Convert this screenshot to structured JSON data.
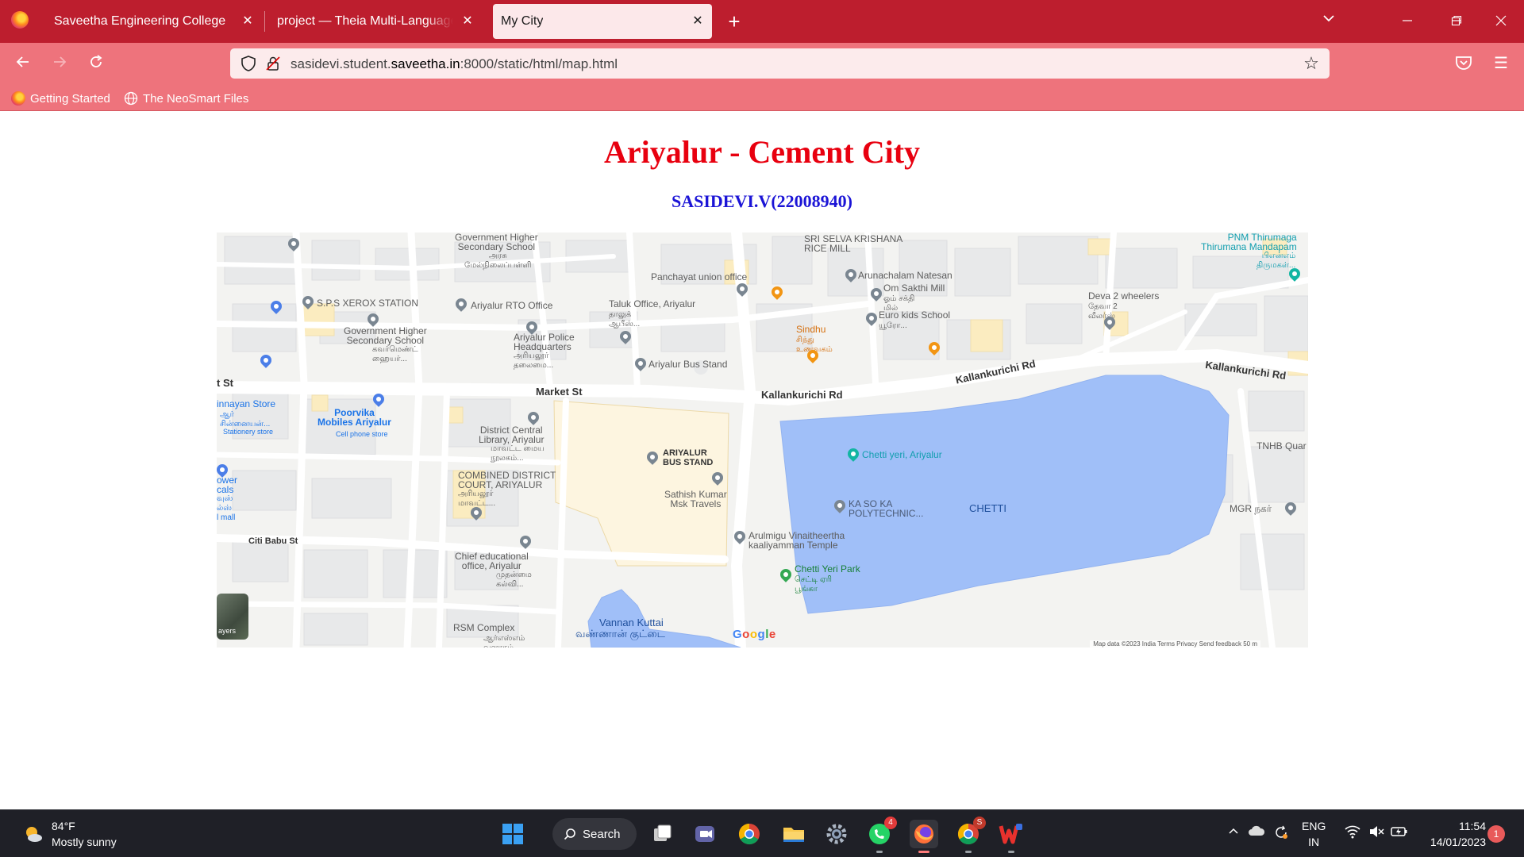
{
  "browser": {
    "tabs": [
      {
        "label": "Saveetha Engineering College"
      },
      {
        "label": "project — Theia Multi-Language Ex"
      },
      {
        "label": "My City"
      }
    ],
    "url": {
      "prefix": "sasidevi.student.",
      "host": "saveetha.in",
      "suffix": ":8000/static/html/map.html"
    },
    "bookmarks": [
      {
        "label": "Getting Started"
      },
      {
        "label": "The NeoSmart Files"
      }
    ]
  },
  "page": {
    "title": "Ariyalur - Cement City",
    "subtitle": "SASIDEVI.V(22008940)"
  },
  "map": {
    "roads": [
      {
        "label": "Market St"
      },
      {
        "label": "Kallankurichi Rd"
      },
      {
        "label": "Kallankurichi Rd"
      },
      {
        "label": "Kallankurichi Rd"
      },
      {
        "label": "Citi Babu St"
      },
      {
        "label": "t St"
      }
    ],
    "places": {
      "gov_school_top": "Government Higher\nSecondary School",
      "gov_school_top_ta": "அரசு\nமேல்நிலைப்பள்ளி",
      "selva": "SRI SELVA KRISHANA\nRICE MILL",
      "panchayat": "Panchayat union office",
      "arunachalam": "Arunachalam Natesan",
      "om_sakthi": "Om Sakthi Mill",
      "om_sakthi_ta": "ஓம் சக்தி\nமில்",
      "thirumana": "PNM Thirumaga\nThirumana Mandapam",
      "thirumana_ta": "பிஎன்எம்\nதிருமகள்...",
      "sps": "S.P.S XEROX STATION",
      "rto": "Ariyalur RTO Office",
      "taluk": "Taluk Office, Ariyalur",
      "taluk_ta": "தாலுக்\nஆபீஸ்...",
      "euro": "Euro kids School",
      "euro_ta": "யூரோ...",
      "deva": "Deva 2 wheelers",
      "deva_ta": "தேவா 2\nவீலர்ஸ்",
      "gov_school_2": "Government Higher\nSecondary School",
      "gov_school_2_ta": "கவர்மெண்ட்\nஹையர்...",
      "police": "Ariyalur Police\nHeadquarters",
      "police_ta": "அரியலூர்\nதலைமை...",
      "sindhu": "Sindhu",
      "sindhu_ta": "சிந்து\nஉணவகம்",
      "bus_stand_pin": "Ariyalur Bus Stand",
      "annayan": "innayan Store",
      "annayan_ta": "ஆர்\nசின்னையன்...",
      "annayan_cat": "Stationery store",
      "poorvika": "Poorvika\nMobiles Ariyalur",
      "poorvika_cat": "Cell phone store",
      "library": "District Central\nLibrary, Ariyalur",
      "library_ta": "மாவட்ட மைய\nநூலகம்...",
      "bus_stand_big": "ARIYALUR\nBUS STAND",
      "chetti_yeri": "Chetti yeri, Ariyalur",
      "tnhb": "TNHB Quar",
      "court": "COMBINED DISTRICT\nCOURT, ARIYALUR",
      "court_ta": "அரியலூர்\nமாவட்ட...",
      "sathish": "Sathish Kumar\nMsk Travels",
      "ka_so_ka": "KA SO KA\nPOLYTECHNIC...",
      "chetti": "CHETTI",
      "mgr": "MGR நகர்",
      "power": "ower\ncals",
      "power_ta": "வுஸ்\nல்ஸ்\nl mall",
      "arulmigu": "Arulmigu Vinaitheertha\nkaaliyamman Temple",
      "chief_edu": "Chief educational\noffice, Ariyalur",
      "chief_edu_ta": "முதன்மை\nகல்வி...",
      "chetti_park": "Chetti Yeri Park",
      "chetti_park_ta": "செட்டி ஏரி\nபூங்கா",
      "rsm": "RSM Complex",
      "rsm_ta": "ஆர்எஸ்எம்\nவளாகம்",
      "vannan": "Vannan Kuttai",
      "vannan_ta": "வண்ணான் குட்டை"
    },
    "layers_label": "ayers",
    "google": "Google",
    "attribution": "Map data ©2023    India    Terms    Privacy    Send feedback    50 m"
  },
  "taskbar": {
    "weather_temp": "84°F",
    "weather_desc": "Mostly sunny",
    "search_label": "Search",
    "whatsapp_badge": "4",
    "chrome_badge": "S",
    "lang_1": "ENG",
    "lang_2": "IN",
    "time": "11:54",
    "date": "14/01/2023",
    "notifications": "1"
  },
  "colors": {
    "tabstrip": "#bd1e2e",
    "toolbar": "#ee737c",
    "title_red": "#e8000f",
    "subtitle_blue": "#1b14d6",
    "water": "#a0bff8",
    "taskbar": "#1f2027"
  }
}
